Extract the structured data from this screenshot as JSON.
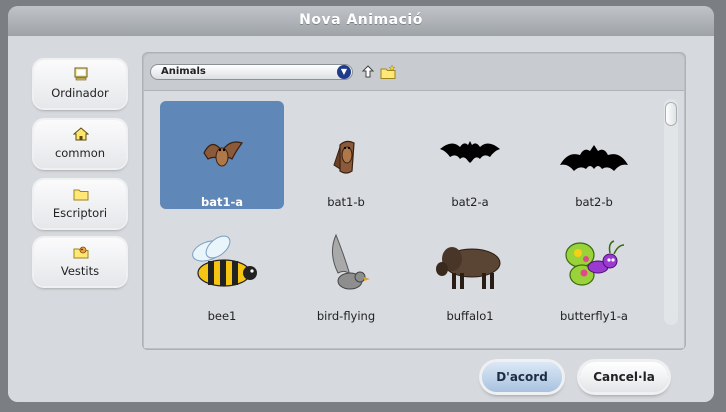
{
  "dialog": {
    "title": "Nova Animació"
  },
  "sidebar": {
    "items": [
      {
        "label": "Ordinador",
        "icon": "computer-icon"
      },
      {
        "label": "common",
        "icon": "home-icon"
      },
      {
        "label": "Escriptori",
        "icon": "folder-icon"
      },
      {
        "label": "Vestits",
        "icon": "costumes-icon"
      }
    ]
  },
  "browser": {
    "folder_select": {
      "value": "Animals"
    },
    "up_icon": "up-folder-icon",
    "new_folder_icon": "new-folder-icon",
    "items": [
      {
        "name": "bat1-a",
        "selected": true
      },
      {
        "name": "bat1-b",
        "selected": false
      },
      {
        "name": "bat2-a",
        "selected": false
      },
      {
        "name": "bat2-b",
        "selected": false
      },
      {
        "name": "bee1",
        "selected": false
      },
      {
        "name": "bird-flying",
        "selected": false
      },
      {
        "name": "buffalo1",
        "selected": false
      },
      {
        "name": "butterfly1-a",
        "selected": false
      }
    ]
  },
  "buttons": {
    "ok_label": "D'acord",
    "cancel_label": "Cancel·la"
  },
  "colors": {
    "selection": "#5f87b8",
    "title_text": "#ffffff",
    "panel": "#d8dbdf"
  }
}
